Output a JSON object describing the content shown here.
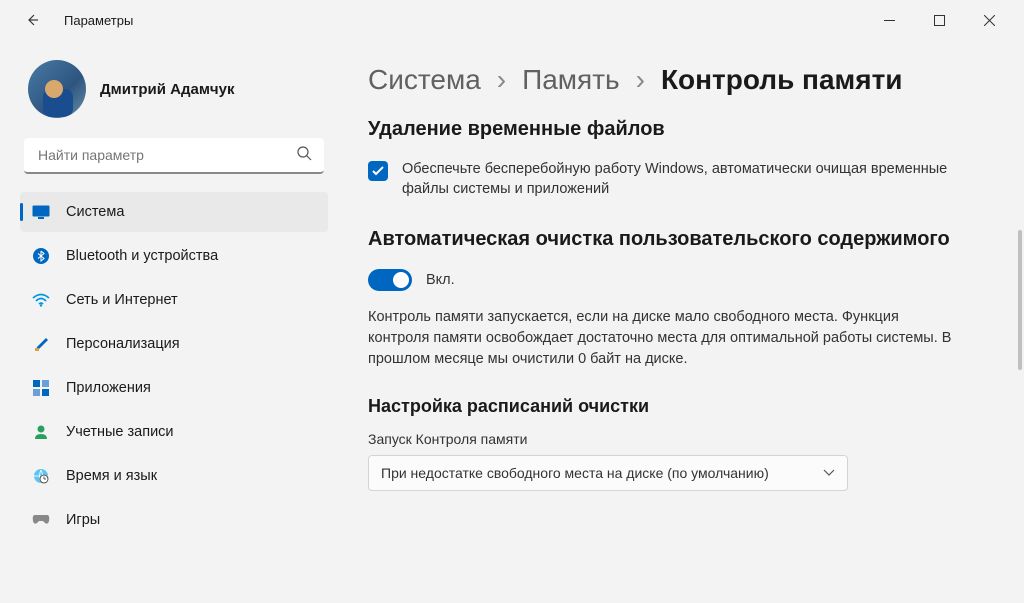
{
  "titlebar": {
    "title": "Параметры"
  },
  "profile": {
    "name": "Дмитрий Адамчук"
  },
  "search": {
    "placeholder": "Найти параметр"
  },
  "nav": {
    "system": "Система",
    "bluetooth": "Bluetooth и устройства",
    "network": "Сеть и Интернет",
    "personalization": "Персонализация",
    "apps": "Приложения",
    "accounts": "Учетные записи",
    "time": "Время и язык",
    "gaming": "Игры"
  },
  "breadcrumb": {
    "l1": "Система",
    "l2": "Память",
    "sep": "›",
    "current": "Контроль памяти"
  },
  "section1": {
    "heading": "Удаление временные файлов",
    "checkbox_label": "Обеспечьте бесперебойную работу Windows, автоматически очищая временные файлы системы и приложений"
  },
  "section2": {
    "heading": "Автоматическая очистка пользовательского содержимого",
    "toggle_state": "Вкл.",
    "description": "Контроль памяти запускается, если на диске мало свободного места. Функция контроля памяти освобождает достаточно места для оптимальной работы системы. В прошлом месяце мы очистили 0 байт на диске."
  },
  "section3": {
    "heading": "Настройка расписаний очистки",
    "field_label": "Запуск Контроля памяти",
    "dropdown_value": "При недостатке свободного места на диске (по умолчанию)"
  }
}
